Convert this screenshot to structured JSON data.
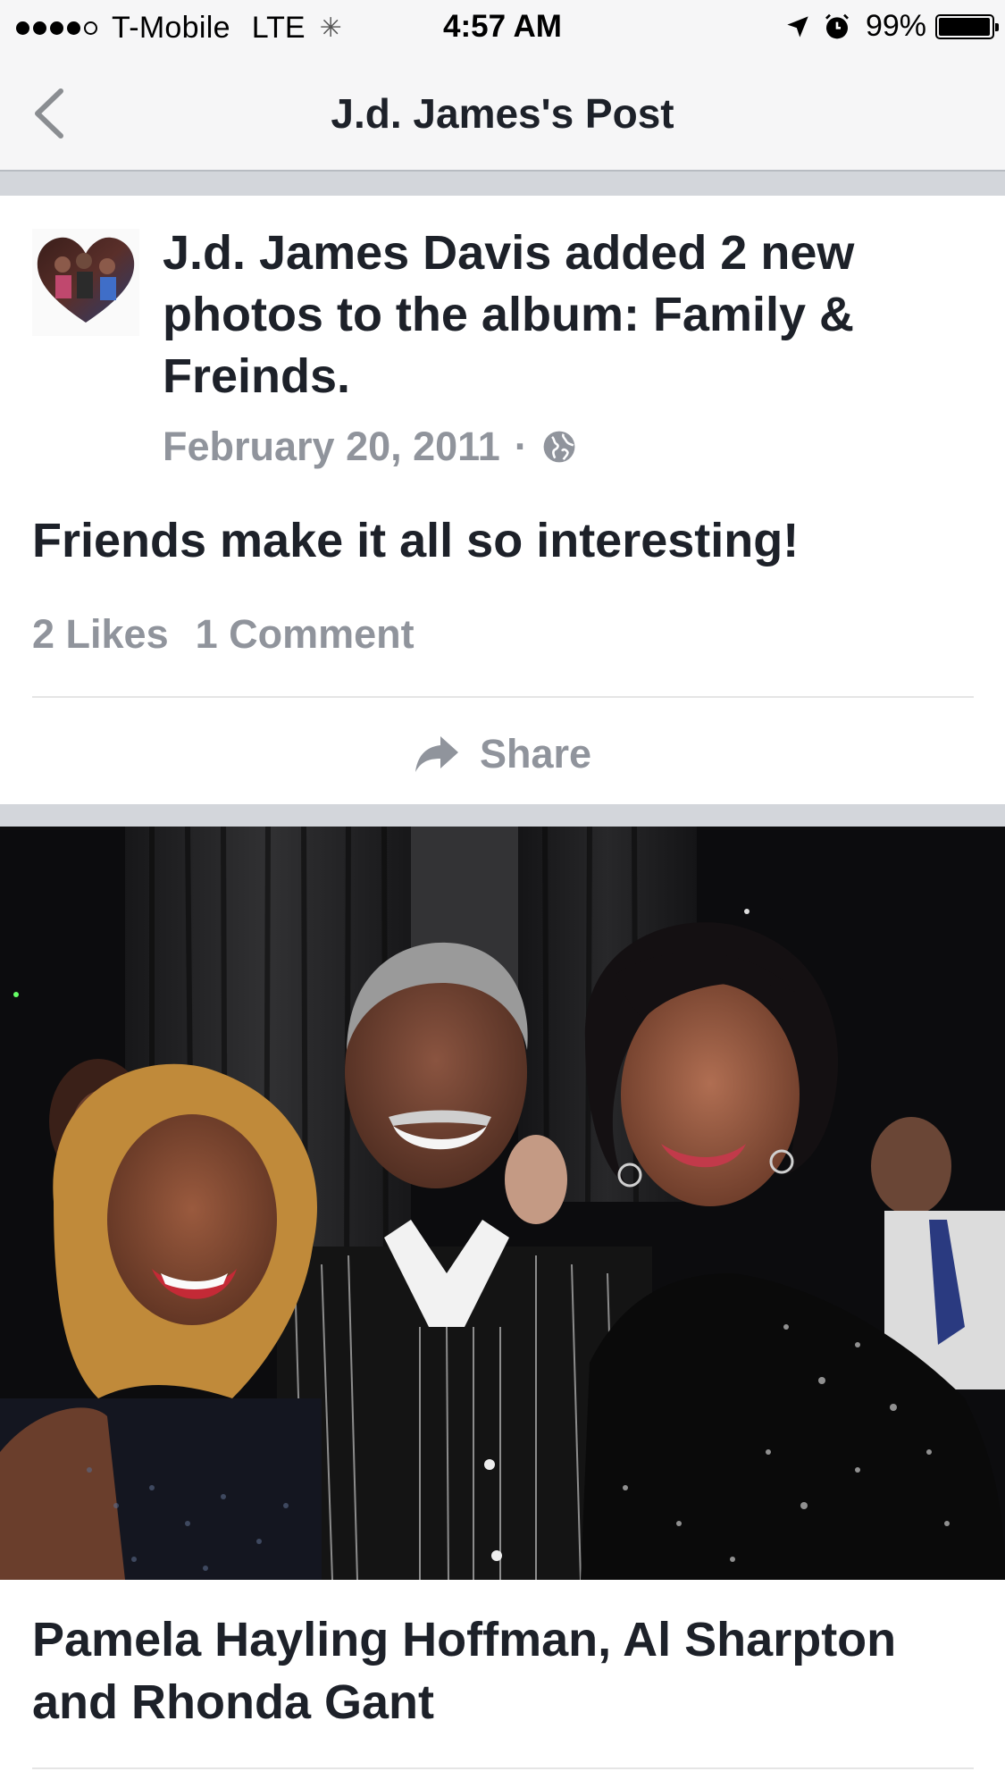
{
  "status_bar": {
    "carrier": "T-Mobile",
    "network": "LTE",
    "time": "4:57 AM",
    "battery_percent": "99%",
    "battery_level": 0.99,
    "icons": [
      "signal-dots-icon",
      "activity-spinner-icon",
      "location-arrow-icon",
      "alarm-clock-icon",
      "battery-icon"
    ]
  },
  "nav": {
    "title": "J.d. James's Post",
    "back_icon": "chevron-left-icon"
  },
  "post": {
    "author": "J.d. James Davis",
    "header_rest": " added 2 new photos to the album: Family & Freinds.",
    "date": "February 20, 2011",
    "separator": "·",
    "privacy_icon": "globe-icon",
    "text": "Friends make it all so interesting!",
    "likes": "2 Likes",
    "comments": "1 Comment",
    "share_label": "Share",
    "share_icon": "share-arrow-icon"
  },
  "photo": {
    "caption": "Pamela Hayling Hoffman, Al Sharpton and Rhonda Gant"
  },
  "colors": {
    "text_primary": "#1d2129",
    "text_secondary": "#90949c",
    "bar_background": "#f6f6f7",
    "separator_band": "#d3d6db"
  }
}
